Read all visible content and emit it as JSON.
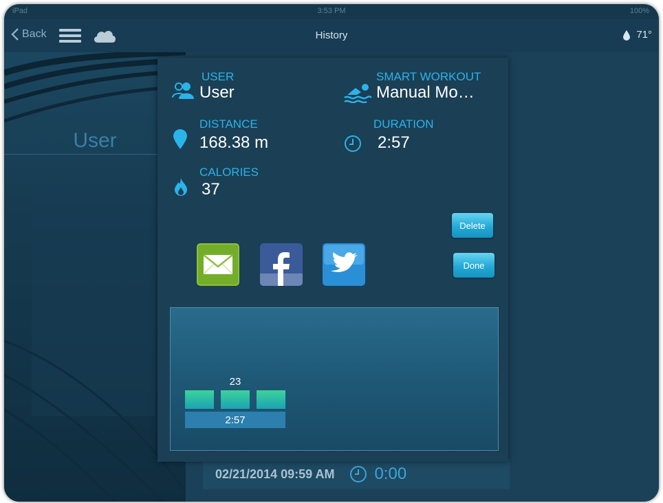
{
  "status_bar": {
    "left": "iPad",
    "time": "3:53 PM",
    "battery": "100%"
  },
  "navbar": {
    "back_label": "Back",
    "title": "History",
    "temperature": "71°"
  },
  "left_panel": {
    "user_name": "User"
  },
  "modal": {
    "user": {
      "label": "USER",
      "value": "User"
    },
    "workout": {
      "label": "SMART WORKOUT",
      "value": "Manual Mo…"
    },
    "distance": {
      "label": "DISTANCE",
      "value": "168.38 m"
    },
    "duration": {
      "label": "DURATION",
      "value": "2:57"
    },
    "calories": {
      "label": "CALORIES",
      "value": "37"
    },
    "delete_label": "Delete",
    "done_label": "Done"
  },
  "history_row": {
    "date": "02/21/2014 09:59 AM",
    "time": "0:00"
  },
  "chart_data": {
    "type": "bar",
    "value_label": "23",
    "duration_label": "2:57",
    "segments": 3,
    "colors": {
      "bar_top": "#3ed39a",
      "bar_bottom": "#1aa3b4",
      "duration_bar": "#2c7fae"
    }
  },
  "colors": {
    "accent": "#2ab4ea",
    "background": "#16384d",
    "button": "#25a9d6"
  }
}
